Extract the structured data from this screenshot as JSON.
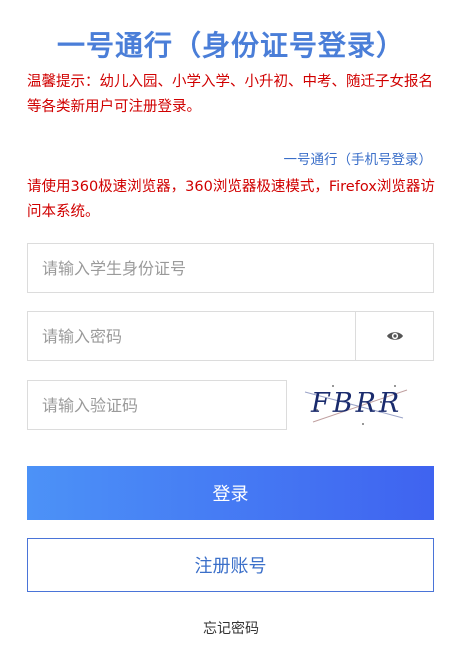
{
  "header": {
    "title": "一号通行（身份证号登录）"
  },
  "notices": {
    "primary": "温馨提示：幼儿入园、小学入学、小升初、中考、随迁子女报名等各类新用户可注册登录。",
    "browser": "请使用360极速浏览器，360浏览器极速模式，Firefox浏览器访问本系统。"
  },
  "alt_login": {
    "label": "一号通行（手机号登录）"
  },
  "form": {
    "id_placeholder": "请输入学生身份证号",
    "password_placeholder": "请输入密码",
    "captcha_placeholder": "请输入验证码",
    "captcha_text": "FBRR",
    "show_password_icon": "eye-icon"
  },
  "buttons": {
    "login": "登录",
    "register": "注册账号",
    "forgot": "忘记密码"
  },
  "colors": {
    "title": "#4a7ed8",
    "notice": "#d00000",
    "link": "#3b6fc9",
    "button_gradient_start": "#4c92f7",
    "button_gradient_end": "#3f63f0"
  }
}
